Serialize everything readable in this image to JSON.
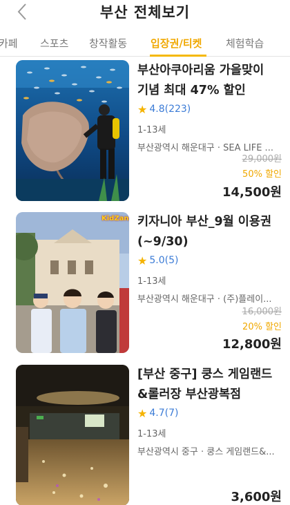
{
  "header": {
    "title": "부산 전체보기"
  },
  "tabs": [
    {
      "label": "카페"
    },
    {
      "label": "스포츠"
    },
    {
      "label": "창작활동"
    },
    {
      "label": "입장권/티켓"
    },
    {
      "label": "체험학습"
    }
  ],
  "items": [
    {
      "title_line1": "부산아쿠아리움 가을맞이",
      "title_line2": "기념 최대 47% 할인",
      "rating": "4.8",
      "reviews": "(223)",
      "age": "1-13세",
      "location": "부산광역시 해운대구 · SEA LIFE ...",
      "original_price": "29,000원",
      "discount": "50% 할인",
      "price": "14,500원"
    },
    {
      "title_line1": "키자니아 부산_9월 이용권",
      "title_line2": "(~9/30)",
      "rating": "5.0",
      "reviews": "(5)",
      "age": "1-13세",
      "location": "부산광역시 해운대구 · (주)플레이...",
      "original_price": "16,000원",
      "discount": "20% 할인",
      "price": "12,800원",
      "logo_text": "KidZania"
    },
    {
      "title_line1": "[부산 중구] 쿵스 게임랜드",
      "title_line2": "&롤러장 부산광복점",
      "rating": "4.7",
      "reviews": "(7)",
      "age": "1-13세",
      "location": "부산광역시 중구 · 쿵스 게임랜드&...",
      "price": "3,600원"
    }
  ],
  "colors": {
    "accent": "#f5b800",
    "rating": "#3b7bd6"
  }
}
